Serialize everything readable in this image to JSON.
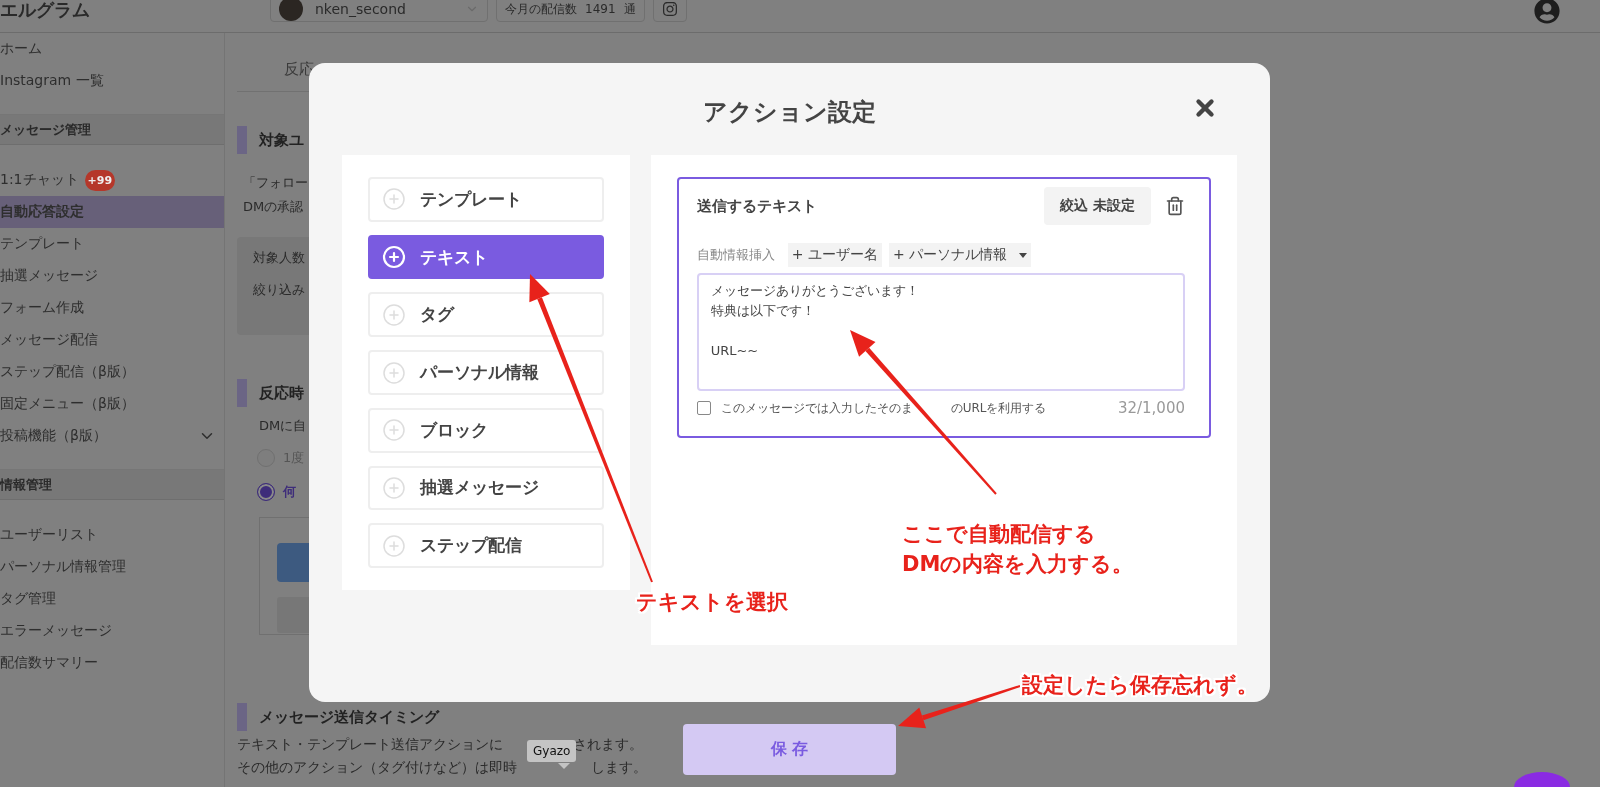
{
  "topbar": {
    "logo": "エルグラム",
    "account": "nken_second",
    "monthly_count": {
      "label": "今月の配信数",
      "value": "1491",
      "unit": "通"
    }
  },
  "sidebar": {
    "groups": [
      {
        "items": [
          {
            "label": "ホーム",
            "selected": false,
            "expandable": false
          },
          {
            "label": "Instagram 一覧",
            "selected": false,
            "expandable": false
          }
        ]
      },
      {
        "heading": "メッセージ管理",
        "items": [
          {
            "label": "1:1チャット",
            "badge": "+99",
            "selected": false,
            "expandable": false
          },
          {
            "label": "自動応答設定",
            "selected": true,
            "expandable": false
          },
          {
            "label": "テンプレート",
            "selected": false,
            "expandable": false
          },
          {
            "label": "抽選メッセージ",
            "selected": false,
            "expandable": false
          },
          {
            "label": "フォーム作成",
            "selected": false,
            "expandable": false
          },
          {
            "label": "メッセージ配信",
            "selected": false,
            "expandable": false
          },
          {
            "label": "ステップ配信（β版）",
            "selected": false,
            "expandable": false
          },
          {
            "label": "固定メニュー（β版）",
            "selected": false,
            "expandable": false
          },
          {
            "label": "投稿機能（β版）",
            "selected": false,
            "expandable": true
          }
        ]
      },
      {
        "heading": "情報管理",
        "items": [
          {
            "label": "ユーザーリスト",
            "selected": false,
            "expandable": false
          },
          {
            "label": "パーソナル情報管理",
            "selected": false,
            "expandable": false
          },
          {
            "label": "タグ管理",
            "selected": false,
            "expandable": false
          },
          {
            "label": "エラーメッセージ",
            "selected": false,
            "expandable": false
          },
          {
            "label": "配信数サマリー",
            "selected": false,
            "expandable": false
          }
        ]
      }
    ]
  },
  "page": {
    "tab": "反応",
    "target_section": {
      "heading": "対象ユ",
      "lines": [
        "「フォロー",
        "DMの承認"
      ],
      "box_lines": [
        "対象人数",
        "絞り込み"
      ]
    },
    "reaction_section": {
      "heading": "反応時",
      "text": "DMに自",
      "options": [
        {
          "label": "1度",
          "selected": false
        },
        {
          "label": "何",
          "selected": true
        }
      ]
    },
    "timing_section": {
      "heading": "メッセージ送信タイミング",
      "lines": [
        [
          "テキスト・テンプレート送信アクションに",
          "されます。"
        ],
        [
          "その他のアクション（タグ付けなど）は即時",
          "します。"
        ]
      ]
    }
  },
  "modal": {
    "title": "アクション設定",
    "action_types": [
      {
        "label": "テンプレート",
        "selected": false
      },
      {
        "label": "テキスト",
        "selected": true
      },
      {
        "label": "タグ",
        "selected": false
      },
      {
        "label": "パーソナル情報",
        "selected": false
      },
      {
        "label": "ブロック",
        "selected": false
      },
      {
        "label": "抽選メッセージ",
        "selected": false
      },
      {
        "label": "ステップ配信",
        "selected": false
      }
    ],
    "editor": {
      "title": "送信するテキスト",
      "filter_button": "絞込 未設定",
      "insert_label": "自動情報挿入",
      "insert_buttons": [
        {
          "label": "+ ユーザー名",
          "kind": "button"
        },
        {
          "label": "+ パーソナル情報",
          "kind": "dropdown"
        }
      ],
      "message_lines": [
        {
          "text": "メッセージありがとうございます！",
          "blank_before": false
        },
        {
          "text": "特典は以下です！",
          "blank_before": false
        },
        {
          "text": "URL~~",
          "blank_before": true
        }
      ],
      "option": {
        "label_parts": [
          "このメッセージでは入力したそのま",
          "のURLを利用する"
        ],
        "checked": false
      },
      "counter": "32/1,000"
    },
    "save_button": "保 存"
  },
  "tooltip": "Gyazo",
  "annotations": [
    {
      "text": "テキストを選択"
    },
    {
      "text": "ここで自動配信する\nDMの内容を入力する。"
    },
    {
      "text": "設定したら保存忘れず。"
    }
  ]
}
